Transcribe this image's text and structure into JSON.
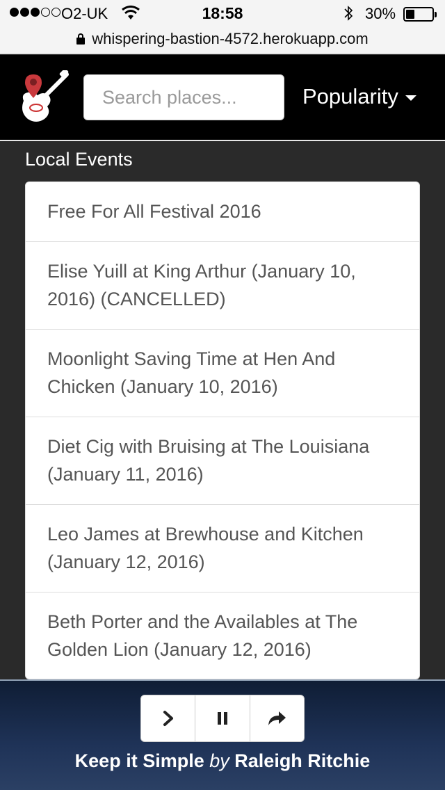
{
  "status_bar": {
    "carrier": "O2-UK",
    "time": "18:58",
    "battery": "30%",
    "url": "whispering-bastion-4572.herokuapp.com"
  },
  "navbar": {
    "search_placeholder": "Search places...",
    "sort_label": "Popularity"
  },
  "events": {
    "title": "Local Events",
    "items": [
      "Free For All Festival 2016",
      "Elise Yuill at King Arthur (January 10, 2016) (CANCELLED)",
      "Moonlight Saving Time at Hen And Chicken (January 10, 2016)",
      "Diet Cig with Bruising at The Louisiana (January 11, 2016)",
      "Leo James at Brewhouse and Kitchen (January 12, 2016)",
      "Beth Porter and the Availables at The Golden Lion (January 12, 2016)",
      ""
    ]
  },
  "player": {
    "song": "Keep it Simple",
    "by": "by",
    "artist": "Raleigh Ritchie"
  }
}
